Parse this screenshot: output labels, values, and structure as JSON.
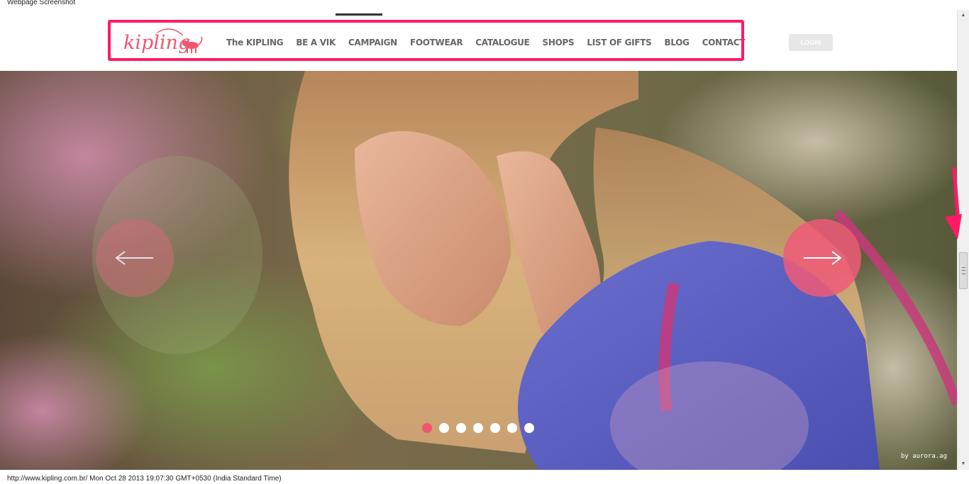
{
  "screenshot_title": "Webpage Screenshot",
  "logo_text": "kipling",
  "nav": {
    "items": [
      {
        "label": "The KIPLING"
      },
      {
        "label": "BE A VIK"
      },
      {
        "label": "CAMPAIGN"
      },
      {
        "label": "FOOTWEAR"
      },
      {
        "label": "CATALOGUE"
      },
      {
        "label": "SHOPS"
      },
      {
        "label": "LIST OF GIFTS"
      },
      {
        "label": "BLOG"
      },
      {
        "label": "CONTACT"
      }
    ],
    "active": "CAMPAIGN"
  },
  "login_label": "LOGIN",
  "slider": {
    "slide_count": 7,
    "active_slide": 1,
    "prev_icon": "arrow-left-icon",
    "next_icon": "arrow-right-icon",
    "credit": "by aurora.ag"
  },
  "footer": {
    "text": "http://www.kipling.com.br/ Mon Oct 28 2013 19:07:30 GMT+0530 (India Standard Time)"
  },
  "colors": {
    "brand_pink": "#f0566f",
    "highlight": "#ff1a63",
    "nav_text": "#666666"
  }
}
